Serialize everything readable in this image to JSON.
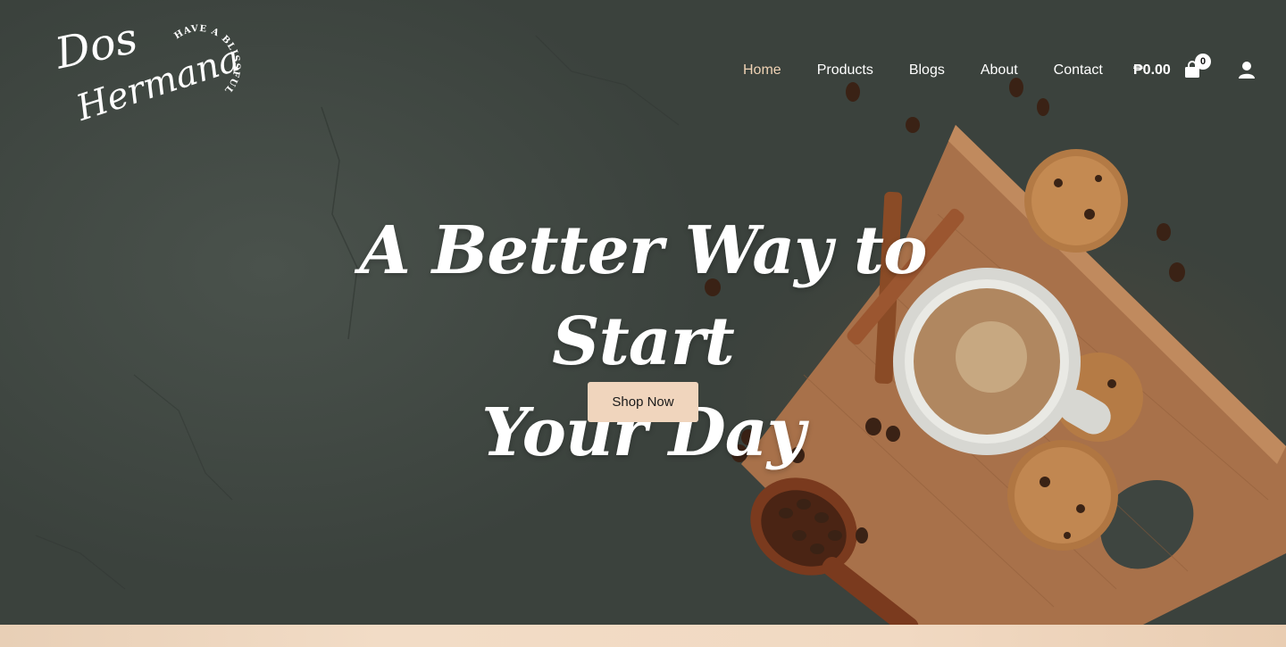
{
  "brand": {
    "name_line1": "Dos",
    "name_line2": "Hermana",
    "tagline": "HAVE A BLISSFUL DAY"
  },
  "nav": {
    "items": [
      {
        "label": "Home",
        "active": true
      },
      {
        "label": "Products",
        "active": false
      },
      {
        "label": "Blogs",
        "active": false
      },
      {
        "label": "About",
        "active": false
      },
      {
        "label": "Contact",
        "active": false
      }
    ]
  },
  "cart": {
    "total": "₱0.00",
    "count": "0",
    "icon": "shopping-bag-icon"
  },
  "account": {
    "icon": "user-icon"
  },
  "hero": {
    "title_line1": "A Better Way to Start",
    "title_line2": "Your Day",
    "cta_label": "Shop Now"
  },
  "colors": {
    "accent": "#f0d5bd",
    "nav_active": "#efd2b4",
    "background": "#3f4641"
  }
}
